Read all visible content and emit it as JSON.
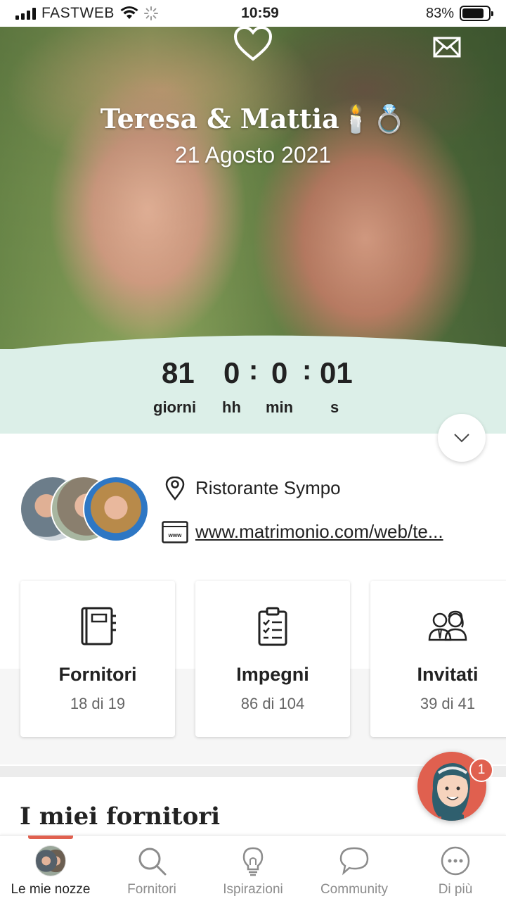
{
  "status_bar": {
    "carrier": "FASTWEB",
    "time": "10:59",
    "battery": "83%",
    "battery_level": 0.83
  },
  "hero": {
    "couple_name": "Teresa & Mattia🕯️💍",
    "date": "21 Agosto 2021"
  },
  "countdown": {
    "days": "81",
    "hours": "0",
    "minutes": "0",
    "seconds": "01",
    "separator": ":",
    "days_label": "giorni",
    "hours_label": "hh",
    "minutes_label": "min",
    "seconds_label": "s",
    "background": "#dcefe8"
  },
  "info": {
    "location": "Ristorante Sympo",
    "website": "www.matrimonio.com/web/te..."
  },
  "cards": [
    {
      "title": "Fornitori",
      "subtitle": "18 di 19",
      "icon": "notebook-icon"
    },
    {
      "title": "Impegni",
      "subtitle": "86 di 104",
      "icon": "checklist-icon"
    },
    {
      "title": "Invitati",
      "subtitle": "39 di 41",
      "icon": "guests-icon"
    }
  ],
  "section": {
    "title": "I miei fornitori"
  },
  "assistant": {
    "badge_count": "1"
  },
  "nav": {
    "accent": "#e0604f",
    "items": [
      {
        "label": "Le mie nozze",
        "icon": "couple-avatar-icon",
        "active": true
      },
      {
        "label": "Fornitori",
        "icon": "search-icon"
      },
      {
        "label": "Ispirazioni",
        "icon": "lightbulb-icon"
      },
      {
        "label": "Community",
        "icon": "chat-bubble-icon"
      },
      {
        "label": "Di più",
        "icon": "more-icon"
      }
    ]
  }
}
